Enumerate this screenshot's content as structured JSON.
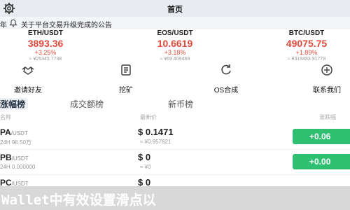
{
  "header": {
    "title": "首页",
    "gear_icon": "gear-icon"
  },
  "notice": {
    "lead": "年",
    "bell_icon": "bell-icon",
    "text": "关于平台交易升级完成的公告"
  },
  "tickers": [
    {
      "symbol": "ETH/USDT",
      "price": "3893.36",
      "change": "+3.25%",
      "volume": "≈ ¥25345.7738"
    },
    {
      "symbol": "EOS/USDT",
      "price": "10.6619",
      "change": "+3.18%",
      "volume": "≈ ¥69.409469"
    },
    {
      "symbol": "BTC/USDT",
      "price": "49075.75",
      "change": "+1.89%",
      "volume": "≈ ¥319483.91778"
    }
  ],
  "quick_actions": [
    {
      "label": "邀请好友",
      "icon": "handshake-icon"
    },
    {
      "label": "挖矿",
      "icon": "mining-icon"
    },
    {
      "label": "OS合成",
      "icon": "refresh-icon"
    },
    {
      "label": "联系我们",
      "icon": "contact-icon"
    }
  ],
  "tabs": [
    "涨幅榜",
    "成交额榜",
    "新币榜"
  ],
  "table_headers": {
    "pair": "名称",
    "price": "最新价",
    "change": "涨跌幅"
  },
  "market_rows": [
    {
      "base": "PA",
      "quote": "/USDT",
      "volume": "24H 96.50万",
      "price": "$ 0.1471",
      "cny": "≈ ¥0.957621",
      "change": "+0.06"
    },
    {
      "base": "PB",
      "quote": "/USDT",
      "volume": "24H 0.000000",
      "price": "$ 0",
      "cny": "≈ ¥0",
      "change": "+0.00"
    },
    {
      "base": "PC",
      "quote": "/USDT",
      "volume": "",
      "price": "$ 0",
      "cny": "",
      "change": ""
    }
  ],
  "banner": {
    "text": "Wallet中有效设置滑点以"
  },
  "colors": {
    "up_red": "#e0493b",
    "buy_green": "#2fbf71",
    "header_bg": "#e8ebf0"
  }
}
